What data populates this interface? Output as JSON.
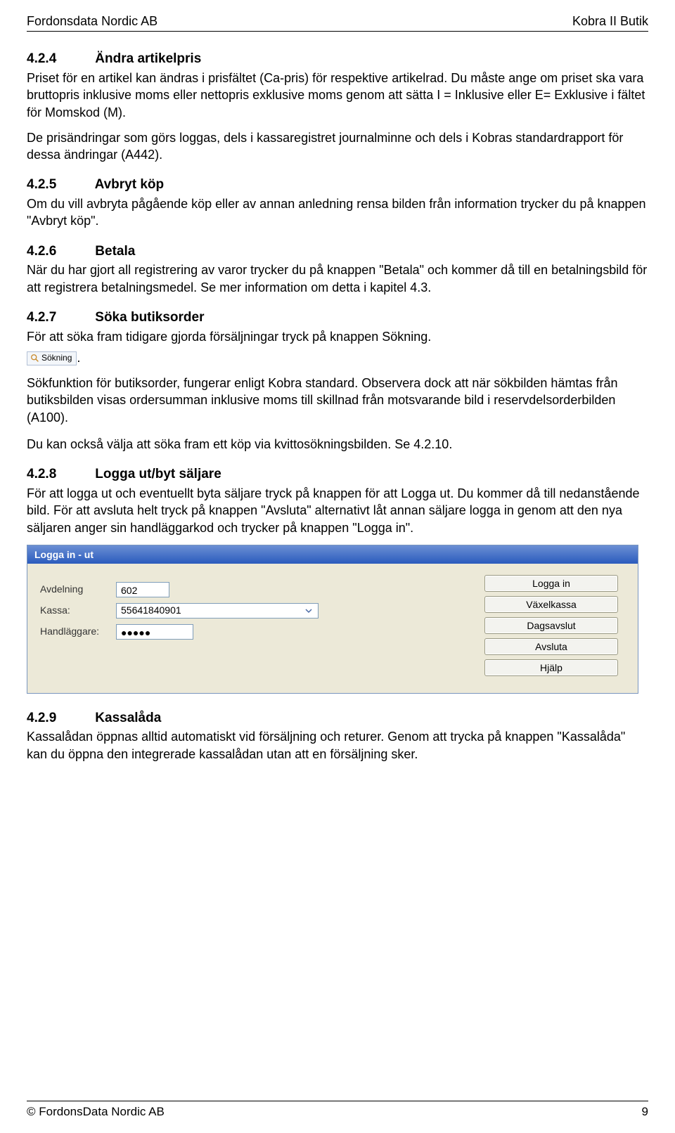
{
  "header": {
    "left": "Fordonsdata Nordic AB",
    "right": "Kobra II Butik"
  },
  "sections": {
    "s424": {
      "num": "4.2.4",
      "title": "Ändra artikelpris",
      "p1": "Priset för en artikel kan ändras i prisfältet (Ca-pris) för respektive artikelrad. Du måste ange om priset ska vara bruttopris inklusive moms eller nettopris exklusive moms genom att sätta I = Inklusive eller E= Exklusive i fältet för Momskod (M).",
      "p2": "De prisändringar som görs loggas, dels i kassaregistret journalminne och dels i Kobras standardrapport för dessa ändringar (A442)."
    },
    "s425": {
      "num": "4.2.5",
      "title": "Avbryt köp",
      "p1": "Om du vill avbryta pågående köp eller av annan anledning rensa bilden från information trycker du på knappen \"Avbryt köp\"."
    },
    "s426": {
      "num": "4.2.6",
      "title": "Betala",
      "p1": "När du har gjort all registrering av varor trycker du på knappen \"Betala\" och kommer då till en betalningsbild för att registrera betalningsmedel. Se mer information om detta i kapitel 4.3."
    },
    "s427": {
      "num": "4.2.7",
      "title": "Söka butiksorder",
      "p1": "För att söka fram tidigare gjorda försäljningar tryck på knappen  Sökning.",
      "search_btn_label": "Sökning",
      "p2": "Sökfunktion för butiksorder, fungerar enligt Kobra standard. Observera dock att när sökbilden hämtas från butiksbilden visas ordersumman inklusive moms till skillnad från motsvarande bild i reservdelsorderbilden (A100).",
      "p3": "Du kan också välja att söka fram ett köp via kvittosökningsbilden. Se 4.2.10."
    },
    "s428": {
      "num": "4.2.8",
      "title": "Logga ut/byt säljare",
      "p1": "För att logga ut och eventuellt byta säljare tryck på knappen för att Logga ut. Du kommer då till nedanstående bild. För att avsluta helt tryck på knappen \"Avsluta\" alternativt låt annan säljare logga in genom att den nya säljaren anger sin handläggarkod och trycker på knappen \"Logga in\"."
    },
    "login": {
      "titlebar": "Logga in - ut",
      "labels": {
        "avdelning": "Avdelning",
        "kassa": "Kassa:",
        "handlaggare": "Handläggare:"
      },
      "values": {
        "avdelning": "602",
        "kassa": "55641840901",
        "handlaggare": "●●●●●"
      },
      "buttons": {
        "login": "Logga in",
        "vaxelkassa": "Växelkassa",
        "dagsavslut": "Dagsavslut",
        "avsluta": "Avsluta",
        "hjalp": "Hjälp"
      }
    },
    "s429": {
      "num": "4.2.9",
      "title": "Kassalåda",
      "p1": "Kassalådan öppnas alltid automatiskt vid försäljning och returer. Genom att trycka på knappen \"Kassalåda\" kan du öppna den integrerade kassalådan utan att en försäljning sker."
    }
  },
  "footer": {
    "left": "© FordonsData Nordic AB",
    "right": "9"
  }
}
